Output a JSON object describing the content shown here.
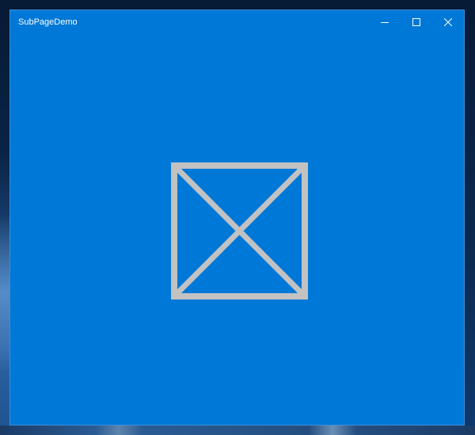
{
  "window": {
    "title": "SubPageDemo",
    "background_color": "#0078d7"
  },
  "caption_buttons": {
    "minimize_icon": "minimize-icon",
    "maximize_icon": "maximize-icon",
    "close_icon": "close-icon"
  },
  "content": {
    "placeholder_icon": "image-placeholder-icon",
    "placeholder_color": "#c2c2c2"
  }
}
